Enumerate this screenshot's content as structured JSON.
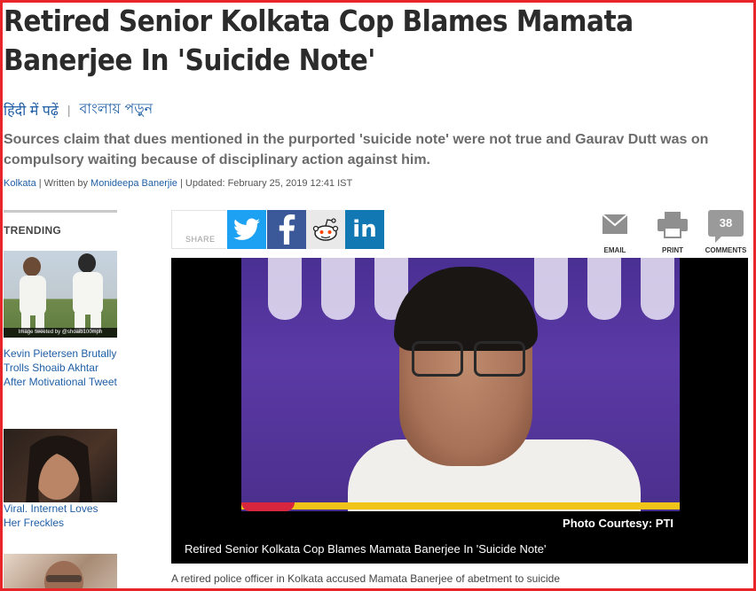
{
  "article": {
    "headline": "Retired Senior Kolkata Cop Blames Mamata Banerjee In 'Suicide Note'",
    "lang_hindi": "हिंदी में पढ़ें",
    "lang_bengali": "বাংলায় পড়ুন",
    "summary": "Sources claim that dues mentioned in the purported 'suicide note' were not true and Gaurav Dutt was on compulsory waiting because of disciplinary action against him.",
    "byline": {
      "location": "Kolkata",
      "written_by_prefix": " | Written by ",
      "author": "Monideepa Banerjie",
      "updated": " | Updated: February 25, 2019 12:41 IST"
    },
    "first_line": "A retired police officer in Kolkata accused Mamata Banerjee of abetment to suicide"
  },
  "share": {
    "label": "SHARE",
    "email_label": "EMAIL",
    "print_label": "PRINT",
    "comments_label": "COMMENTS",
    "comments_count": "38"
  },
  "hero": {
    "photo_credit": "Photo Courtesy: PTI",
    "caption": "Retired Senior Kolkata Cop Blames Mamata Banerjee In 'Suicide Note'"
  },
  "trending": {
    "title": "TRENDING",
    "items": [
      {
        "image_caption": "Image tweeted by @shoaib100mph",
        "text": "Kevin Pietersen Brutally Trolls Shoaib Akhtar After Motivational Tweet"
      },
      {
        "text": "Viral. Internet Loves Her Freckles"
      }
    ]
  },
  "colors": {
    "frame": "#e8262a",
    "link": "#1f5fa6",
    "twitter": "#1da1f2",
    "facebook": "#3b5998",
    "linkedin": "#1178b3"
  }
}
